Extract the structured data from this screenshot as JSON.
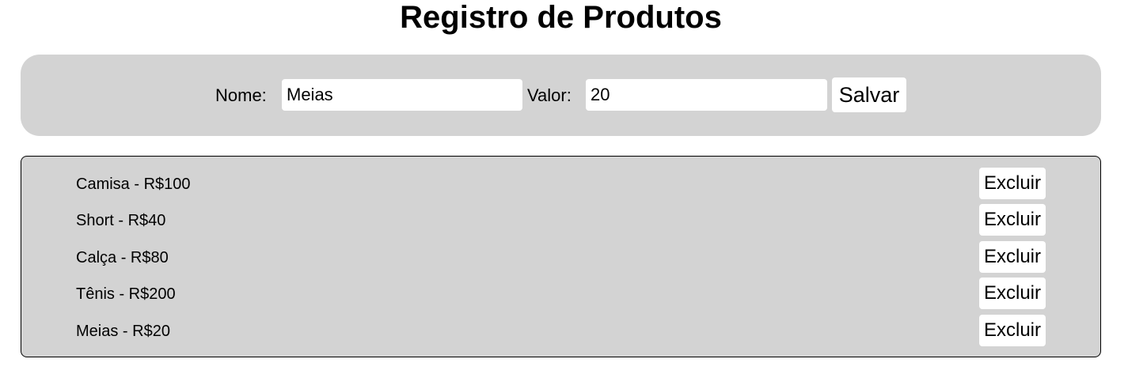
{
  "header": {
    "title": "Registro de Produtos"
  },
  "form": {
    "name_label": "Nome:",
    "name_value": "Meias",
    "value_label": "Valor:",
    "value_value": "20",
    "save_label": "Salvar"
  },
  "products": {
    "items": [
      {
        "label": "Camisa - R$100",
        "delete_label": "Excluir"
      },
      {
        "label": "Short - R$40",
        "delete_label": "Excluir"
      },
      {
        "label": "Calça - R$80",
        "delete_label": "Excluir"
      },
      {
        "label": "Tênis - R$200",
        "delete_label": "Excluir"
      },
      {
        "label": "Meias - R$20",
        "delete_label": "Excluir"
      }
    ]
  },
  "colors": {
    "panel_background": "#d3d3d3",
    "page_background": "#ffffff",
    "control_background": "#ffffff",
    "text": "#000000"
  }
}
